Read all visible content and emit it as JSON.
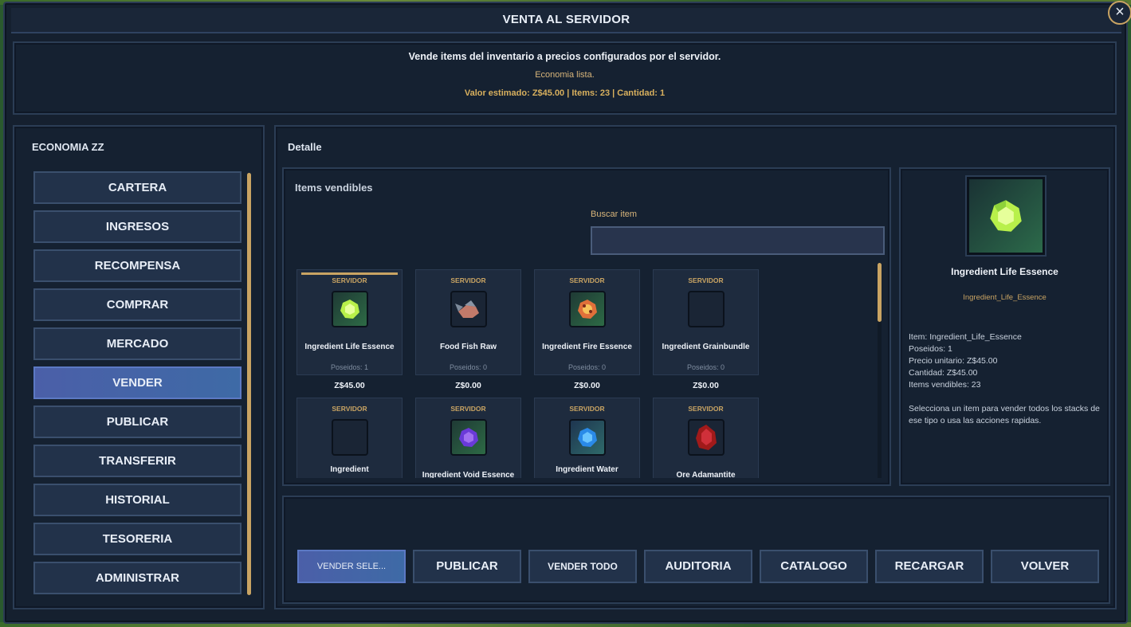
{
  "window": {
    "title": "VENTA AL SERVIDOR"
  },
  "info": {
    "title": "Vende items del inventario a precios configurados por el servidor.",
    "status": "Economia lista.",
    "estimate": "Valor estimado: Z$45.00 | Items: 23 | Cantidad: 1"
  },
  "nav": {
    "heading": "ECONOMIA ZZ",
    "items": [
      {
        "label": "CARTERA"
      },
      {
        "label": "INGRESOS"
      },
      {
        "label": "RECOMPENSA"
      },
      {
        "label": "COMPRAR"
      },
      {
        "label": "MERCADO"
      },
      {
        "label": "VENDER",
        "active": true
      },
      {
        "label": "PUBLICAR"
      },
      {
        "label": "TRANSFERIR"
      },
      {
        "label": "HISTORIAL"
      },
      {
        "label": "TESORERIA"
      },
      {
        "label": "ADMINISTRAR"
      }
    ]
  },
  "detail": {
    "heading": "Detalle",
    "items_heading": "Items vendibles",
    "search_label": "Buscar item",
    "search_value": "",
    "items": [
      {
        "tag": "SERVIDOR",
        "name": "Ingredient Life Essence",
        "owned": "Poseidos: 1",
        "price": "Z$45.00",
        "icon": "life-essence-icon",
        "selected": true
      },
      {
        "tag": "SERVIDOR",
        "name": "Food Fish Raw",
        "owned": "Poseidos: 0",
        "price": "Z$0.00",
        "icon": "raw-fish-icon"
      },
      {
        "tag": "SERVIDOR",
        "name": "Ingredient Fire Essence",
        "owned": "Poseidos: 0",
        "price": "Z$0.00",
        "icon": "fire-essence-icon"
      },
      {
        "tag": "SERVIDOR",
        "name": "Ingredient Grainbundle",
        "owned": "Poseidos: 0",
        "price": "Z$0.00",
        "icon": "empty-slot-icon"
      },
      {
        "tag": "SERVIDOR",
        "name": "Ingredient",
        "icon": "empty-slot-icon"
      },
      {
        "tag": "SERVIDOR",
        "name": "Ingredient Void Essence",
        "icon": "void-essence-icon"
      },
      {
        "tag": "SERVIDOR",
        "name": "Ingredient Water",
        "icon": "water-essence-icon"
      },
      {
        "tag": "SERVIDOR",
        "name": "Ore Adamantite",
        "icon": "adamantite-ore-icon"
      }
    ]
  },
  "preview": {
    "name": "Ingredient Life Essence",
    "id": "Ingredient_Life_Essence",
    "lines": [
      "Item: Ingredient_Life_Essence",
      "Poseidos: 1",
      "Precio unitario: Z$45.00",
      "Cantidad: Z$45.00",
      "Items vendibles: 23"
    ],
    "hint": "Selecciona un item para vender todos los stacks de ese tipo o usa las acciones rapidas."
  },
  "actions": [
    {
      "label": "VENDER SELE...",
      "style": "primary"
    },
    {
      "label": "PUBLICAR"
    },
    {
      "label": "VENDER TODO",
      "style": "small"
    },
    {
      "label": "AUDITORIA"
    },
    {
      "label": "CATALOGO"
    },
    {
      "label": "RECARGAR"
    },
    {
      "label": "VOLVER"
    }
  ],
  "colors": {
    "accent": "#c9a463",
    "active": "#4b5fa8",
    "panel": "#152131"
  }
}
